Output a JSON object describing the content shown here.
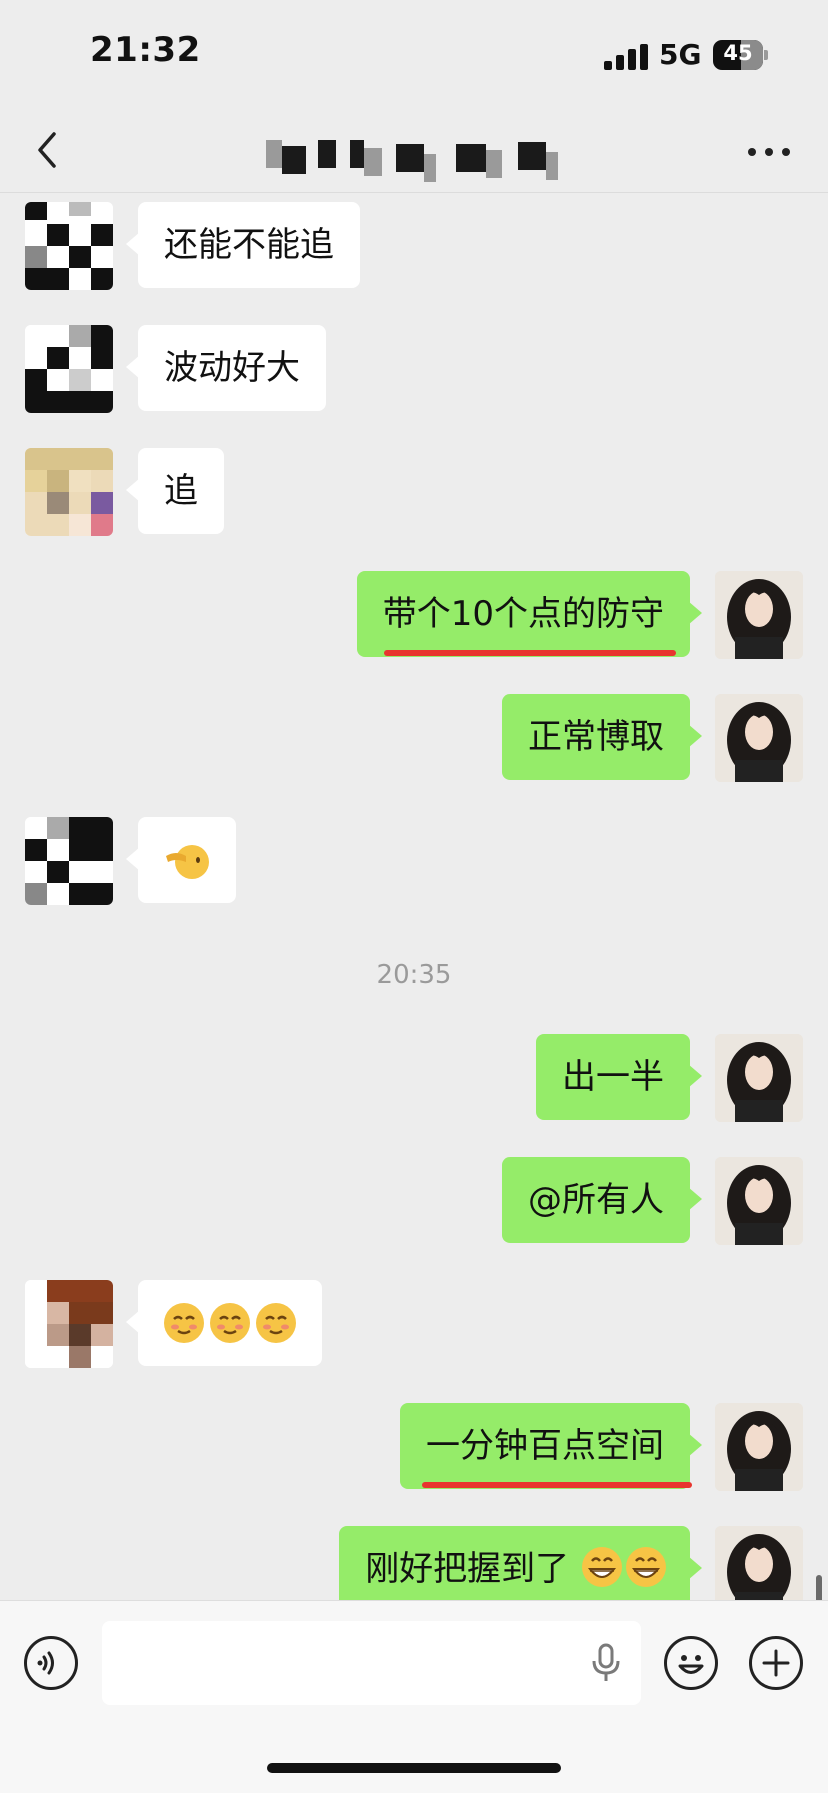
{
  "status_bar": {
    "time": "21:32",
    "network": "5G",
    "battery": "45"
  },
  "nav": {
    "icons": [
      "chevron-left-icon",
      "more-horizontal-icon"
    ]
  },
  "messages": [
    {
      "side": "left",
      "text": "还能不能追"
    },
    {
      "side": "left",
      "text": "波动好大"
    },
    {
      "side": "left",
      "text": "追"
    },
    {
      "side": "right",
      "text": "带个10个点的防守",
      "highlight": true
    },
    {
      "side": "right",
      "text": "正常博取"
    },
    {
      "side": "left",
      "emoji": "pointing-left-face-emoji"
    },
    {
      "timestamp": "20:35"
    },
    {
      "side": "right",
      "text": "出一半"
    },
    {
      "side": "right",
      "text": "@所有人"
    },
    {
      "side": "left",
      "emoji": "smiling-face-x3-emoji"
    },
    {
      "side": "right",
      "text": "一分钟百点空间",
      "highlight": true
    },
    {
      "side": "right",
      "text": "刚好把握到了",
      "emoji": "grinning-face-x2-emoji"
    }
  ],
  "colors": {
    "background": "#ededed",
    "self_bubble": "#95ec69",
    "other_bubble": "#ffffff",
    "underline": "#e8352e"
  },
  "input_bar": {
    "icons": [
      "voice-icon",
      "microphone-icon",
      "emoji-icon",
      "plus-icon"
    ]
  }
}
